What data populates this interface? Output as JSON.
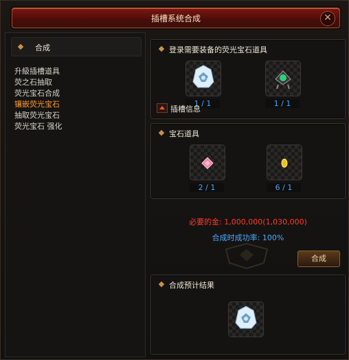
{
  "window": {
    "title": "插槽系统合成",
    "close_icon": "close-icon"
  },
  "sidebar": {
    "header": "合成",
    "items": [
      {
        "label": "升級插槽道具",
        "active": false
      },
      {
        "label": "荧之石抽取",
        "active": false
      },
      {
        "label": "荧光宝石合成",
        "active": false
      },
      {
        "label": "镶嵌荧光宝石",
        "active": true
      },
      {
        "label": "抽取荧光宝石",
        "active": false
      },
      {
        "label": "荧光宝石 强化",
        "active": false
      }
    ]
  },
  "equipment_panel": {
    "title": "登录需要装备的荧光宝石道具",
    "slots": [
      {
        "icon": "crystal-helmet-icon",
        "count": "1 / 1"
      },
      {
        "icon": "green-jewel-amulet-icon",
        "count": "1 / 1"
      }
    ],
    "insert_info_label": "插槽信息"
  },
  "gem_panel": {
    "title": "宝石道具",
    "slots": [
      {
        "icon": "pink-gem-icon",
        "count": "2 / 1"
      },
      {
        "icon": "gold-gem-icon",
        "count": "6 / 1"
      }
    ]
  },
  "cost": {
    "required_gold": "必要的金: 1,000,000(1,030,000)",
    "success_rate": "合成时成功率: 100%"
  },
  "combine_button": "合成",
  "result_panel": {
    "title": "合成预计结果",
    "slot": {
      "icon": "crystal-helmet-icon"
    }
  },
  "colors": {
    "title_red": "#4c0c09",
    "active_item": "#ff9a2a",
    "count_blue": "#4aa8ff",
    "cost_red": "#ff3a2a"
  }
}
